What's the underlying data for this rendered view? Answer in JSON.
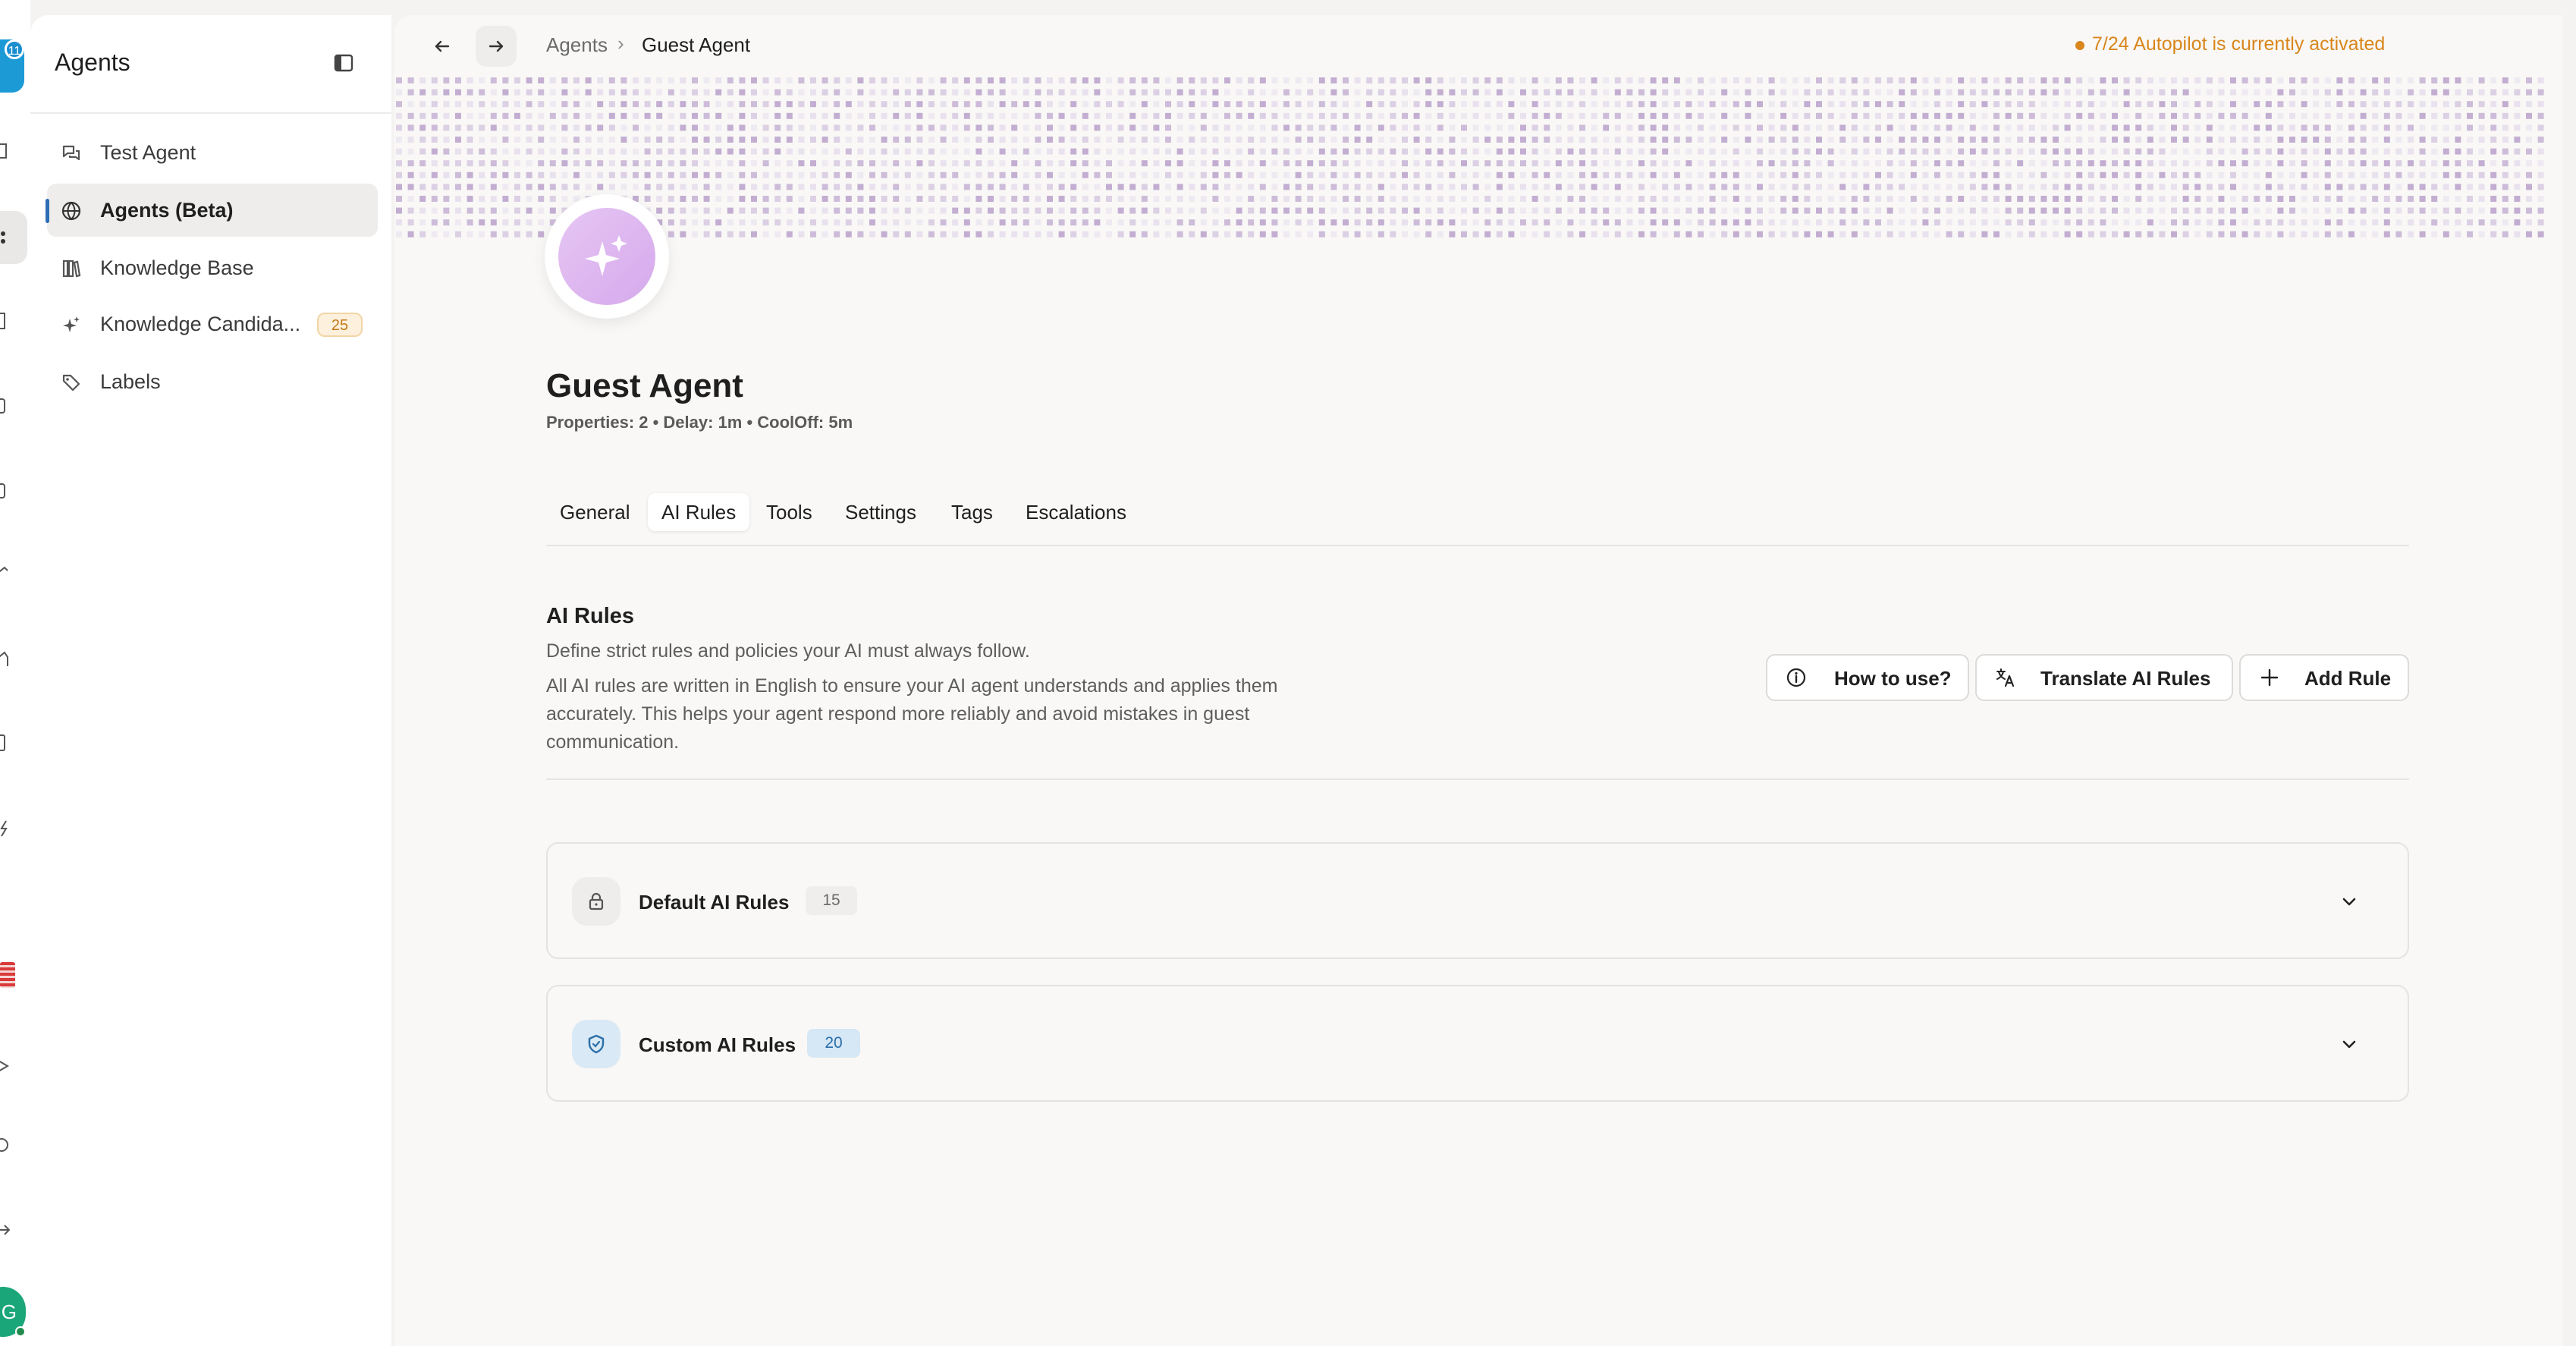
{
  "rail": {
    "notification_count": "11",
    "user_initial": "G"
  },
  "sidebar": {
    "title": "Agents",
    "items": [
      {
        "label": "Test Agent",
        "icon": "chat-bubbles-icon"
      },
      {
        "label": "Agents (Beta)",
        "icon": "globe-icon",
        "active": true
      },
      {
        "label": "Knowledge Base",
        "icon": "books-icon"
      },
      {
        "label": "Knowledge Candida...",
        "icon": "sparkles-icon",
        "badge": "25"
      },
      {
        "label": "Labels",
        "icon": "tags-icon"
      }
    ]
  },
  "header": {
    "breadcrumb_root": "Agents",
    "breadcrumb_sep": "›",
    "breadcrumb_current": "Guest Agent",
    "autopilot_status": "7/24 Autopilot is currently activated"
  },
  "agent": {
    "name": "Guest Agent",
    "meta": "Properties: 2 • Delay: 1m • CoolOff: 5m"
  },
  "tabs": [
    {
      "label": "General"
    },
    {
      "label": "AI Rules",
      "active": true
    },
    {
      "label": "Tools"
    },
    {
      "label": "Settings"
    },
    {
      "label": "Tags"
    },
    {
      "label": "Escalations"
    }
  ],
  "section": {
    "title": "AI Rules",
    "subtitle": "Define strict rules and policies your AI must always follow.",
    "description": "All AI rules are written in English to ensure your AI agent understands and applies them accurately. This helps your agent respond more reliably and avoid mistakes in guest communication."
  },
  "actions": {
    "how_to_use": "How to use?",
    "translate": "Translate AI Rules",
    "add_rule": "Add Rule"
  },
  "rule_groups": [
    {
      "title": "Default AI Rules",
      "count": "15",
      "icon": "lock-icon"
    },
    {
      "title": "Custom AI Rules",
      "count": "20",
      "icon": "shield-icon"
    }
  ],
  "colors": {
    "accent_orange": "#d9861c",
    "accent_blue": "#2a6fa8",
    "avatar_purple": "#d6a9ec"
  }
}
